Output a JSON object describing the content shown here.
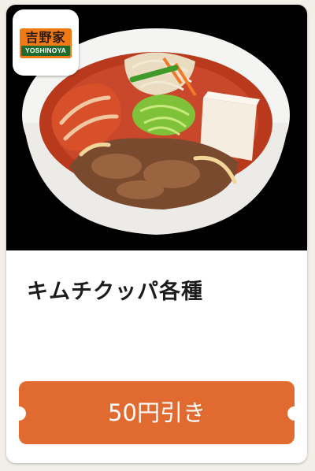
{
  "brand": {
    "logo_kanji": "吉野家",
    "logo_roman": "YOSHINOYA"
  },
  "product": {
    "title": "キムチクッパ各種"
  },
  "coupon": {
    "label": "50円引き"
  },
  "colors": {
    "coupon_background": "#e06a2f",
    "photo_background": "#000000",
    "logo_orange": "#f07a16",
    "logo_green": "#1f6a2c"
  }
}
